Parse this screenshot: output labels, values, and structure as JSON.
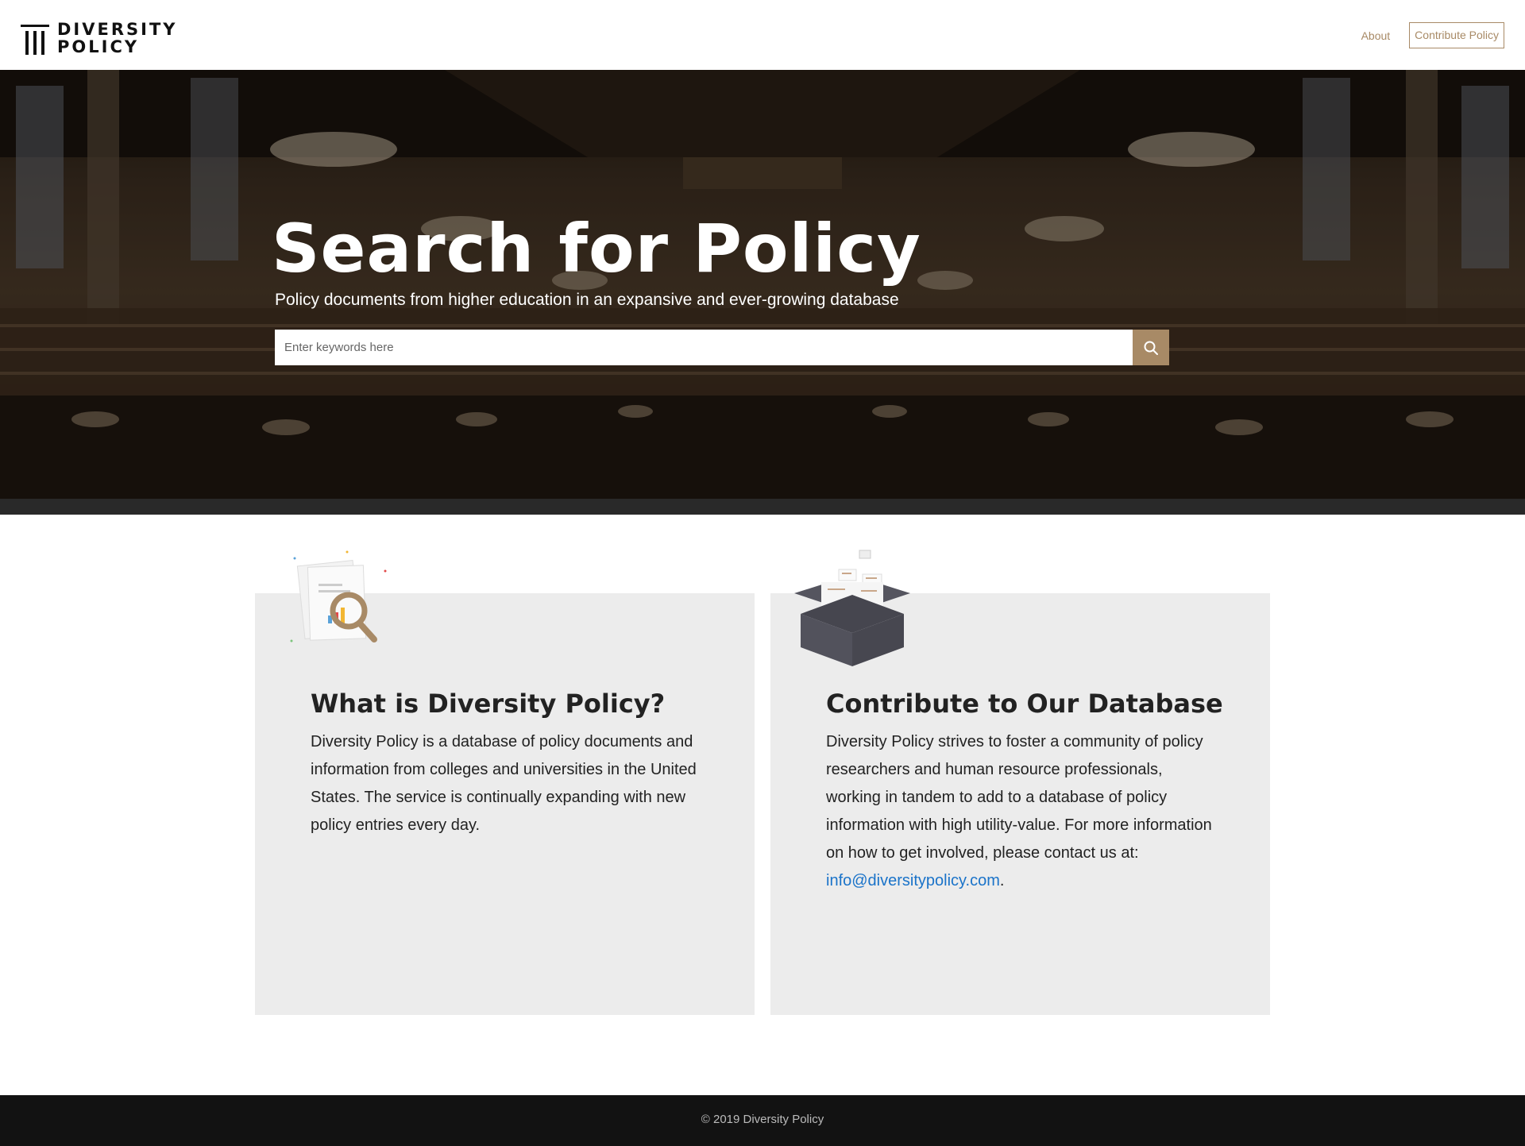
{
  "header": {
    "logo_line1": "DIVERSITY",
    "logo_line2": "POLICY",
    "nav_about": "About",
    "nav_contribute": "Contribute Policy"
  },
  "hero": {
    "title": "Search for Policy",
    "subtitle": "Policy documents from higher education in an expansive and ever-growing database",
    "search_placeholder": "Enter keywords here",
    "search_icon": "search-icon"
  },
  "cards": [
    {
      "icon": "document-magnifier-icon",
      "title": "What is Diversity Policy?",
      "text": "Diversity Policy is a database of policy documents and information from colleges and universities in the United States. The service is continually expanding with new policy entries every day."
    },
    {
      "icon": "open-box-icon",
      "title": "Contribute to Our Database",
      "text_before": "Diversity Policy strives to foster a community of policy researchers and human resource professionals, working in tandem to add to a database of policy information with high utility-value. For more information on how to get involved, please contact us at: ",
      "email": "info@diversitypolicy.com",
      "text_after": "."
    }
  ],
  "footer": {
    "copyright": "© 2019 Diversity Policy"
  },
  "colors": {
    "accent": "#a88a66",
    "link": "#1a73c9",
    "card_bg": "#ececec",
    "footer_bg": "#121212"
  }
}
